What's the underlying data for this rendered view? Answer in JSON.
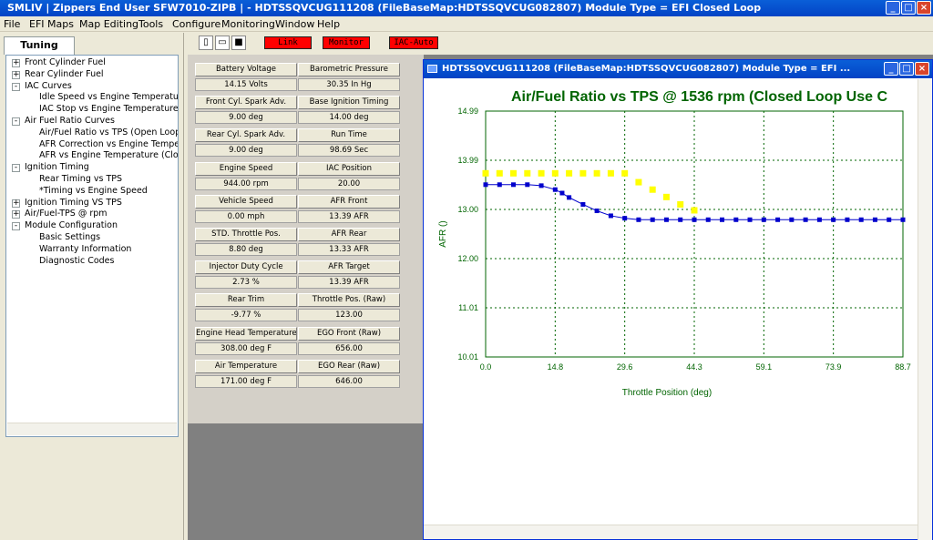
{
  "app": {
    "title": "SMLIV  | Zippers End User SFW7010-ZIPB |    - HDTSSQVCUG111208      (FileBaseMap:HDTSSQVCUG082807) Module Type = EFI Closed Loop"
  },
  "menu": [
    "File",
    "EFI Maps",
    "Map Editing",
    "Tools",
    "Configure",
    "Monitoring",
    "Window",
    "Help"
  ],
  "left": {
    "tab": "Tuning Maps",
    "tree": [
      {
        "label": "Front Cylinder Fuel",
        "level": 0,
        "exp": "+"
      },
      {
        "label": "Rear Cylinder Fuel",
        "level": 0,
        "exp": "+"
      },
      {
        "label": "IAC Curves",
        "level": 0,
        "exp": "-"
      },
      {
        "label": "Idle Speed vs Engine Temperature",
        "level": 1
      },
      {
        "label": "IAC Stop vs Engine Temperature",
        "level": 1
      },
      {
        "label": "Air Fuel Ratio Curves",
        "level": 0,
        "exp": "-"
      },
      {
        "label": "Air/Fuel Ratio vs TPS (Open Loop Use",
        "level": 1
      },
      {
        "label": "AFR Correction vs Engine Temperature",
        "level": 1
      },
      {
        "label": "AFR vs Engine Temperature     (Closed",
        "level": 1
      },
      {
        "label": "Ignition Timing",
        "level": 0,
        "exp": "-"
      },
      {
        "label": "Rear Timing vs TPS",
        "level": 1
      },
      {
        "label": "*Timing vs Engine Speed",
        "level": 1
      },
      {
        "label": "Ignition Timing VS TPS",
        "level": 0,
        "exp": "+"
      },
      {
        "label": "Air/Fuel-TPS @ rpm",
        "level": 0,
        "exp": "+"
      },
      {
        "label": "Module Configuration",
        "level": 0,
        "exp": "-"
      },
      {
        "label": "Basic Settings",
        "level": 1
      },
      {
        "label": "Warranty Information",
        "level": 1
      },
      {
        "label": "Diagnostic Codes",
        "level": 1
      }
    ]
  },
  "toolbar": {
    "link": "Link",
    "monitor": "Monitor",
    "iac": "IAC-Auto"
  },
  "data": [
    {
      "l1": "Battery Voltage",
      "v1": "14.15  Volts",
      "l2": "Barometric Pressure",
      "v2": "30.35  In Hg"
    },
    {
      "l1": "Front Cyl. Spark Adv.",
      "v1": "9.00  deg",
      "l2": "Base Ignition Timing",
      "v2": "14.00  deg"
    },
    {
      "l1": "Rear Cyl. Spark Adv.",
      "v1": "9.00  deg",
      "l2": "Run Time",
      "v2": "98.69  Sec"
    },
    {
      "l1": "Engine Speed",
      "v1": "944.00  rpm",
      "l2": "IAC Position",
      "v2": "20.00"
    },
    {
      "l1": "Vehicle Speed",
      "v1": "0.00  mph",
      "l2": "AFR Front",
      "v2": "13.39  AFR"
    },
    {
      "l1": "STD. Throttle Pos.",
      "v1": "8.80  deg",
      "l2": "AFR Rear",
      "v2": "13.33  AFR"
    },
    {
      "l1": "Injector Duty Cycle",
      "v1": "2.73  %",
      "l2": "AFR Target",
      "v2": "13.39  AFR"
    },
    {
      "l1": "Rear Trim",
      "v1": "-9.77  %",
      "l2": "Throttle Pos. (Raw)",
      "v2": "123.00"
    },
    {
      "l1": "Engine Head Temperature",
      "v1": "308.00  deg F",
      "l2": "EGO Front (Raw)",
      "v2": "656.00"
    },
    {
      "l1": "Air Temperature",
      "v1": "171.00  deg F",
      "l2": "EGO Rear (Raw)",
      "v2": "646.00"
    }
  ],
  "chartwin": {
    "title": "HDTSSQVCUG111208      (FileBaseMap:HDTSSQVCUG082807) Module Type = EFI ..."
  },
  "chart_data": {
    "type": "line",
    "title": "Air/Fuel Ratio vs TPS @ 1536 rpm   (Closed Loop Use C",
    "xlabel": "Throttle Position (deg)",
    "ylabel": "AFR ()",
    "xlim": [
      0,
      88.7
    ],
    "ylim": [
      10.01,
      14.99
    ],
    "xticks": [
      "0.0",
      "14.8",
      "29.6",
      "44.3",
      "59.1",
      "73.9",
      "88.7"
    ],
    "yticks": [
      "10.01",
      "11.01",
      "12.00",
      "13.00",
      "13.99",
      "14.99"
    ],
    "grid": true,
    "colors": {
      "title": "#006400",
      "grid": "#006400",
      "series1": "#0000cc",
      "series2": "#ffff00"
    },
    "series": [
      {
        "color": "#0000cc",
        "x": [
          0,
          2.96,
          5.91,
          8.87,
          11.83,
          14.78,
          16.26,
          17.74,
          20.7,
          23.65,
          26.61,
          29.57,
          32.52,
          35.48,
          38.43,
          41.39,
          44.35,
          47.3,
          50.26,
          53.22,
          56.17,
          59.13,
          62.09,
          65.04,
          68,
          70.96,
          73.91,
          76.87,
          79.83,
          82.78,
          85.74,
          88.7
        ],
        "y": [
          13.5,
          13.5,
          13.5,
          13.5,
          13.48,
          13.4,
          13.33,
          13.24,
          13.1,
          12.97,
          12.87,
          12.82,
          12.79,
          12.79,
          12.79,
          12.79,
          12.79,
          12.79,
          12.79,
          12.79,
          12.79,
          12.79,
          12.79,
          12.79,
          12.79,
          12.79,
          12.79,
          12.79,
          12.79,
          12.79,
          12.79,
          12.79
        ]
      },
      {
        "color": "#ffff00",
        "x": [
          0,
          2.96,
          5.91,
          8.87,
          11.83,
          14.78,
          17.74,
          20.7,
          23.65,
          26.61,
          29.57,
          32.52,
          35.48,
          38.43,
          41.39,
          44.35
        ],
        "y": [
          13.73,
          13.73,
          13.73,
          13.73,
          13.73,
          13.73,
          13.73,
          13.73,
          13.73,
          13.73,
          13.73,
          13.55,
          13.4,
          13.25,
          13.1,
          12.98
        ]
      }
    ]
  }
}
